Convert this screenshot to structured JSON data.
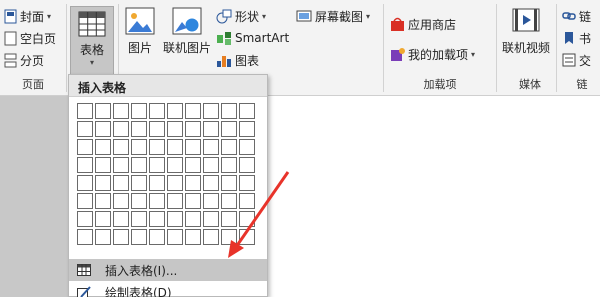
{
  "ribbon": {
    "page_group": {
      "label": "页面",
      "cover": "封面",
      "blank": "空白页",
      "page_break": "分页"
    },
    "table_button": {
      "label": "表格"
    },
    "illustrations": {
      "picture": "图片",
      "online_picture": "联机图片",
      "shapes": "形状",
      "smartart": "SmartArt",
      "chart": "图表",
      "screenshot": "屏幕截图"
    },
    "addins": {
      "label": "加载项",
      "store": "应用商店",
      "my_addins": "我的加载项"
    },
    "media": {
      "label": "媒体",
      "online_video": "联机视频"
    },
    "links": {
      "label": "链",
      "link": "链",
      "bookmark": "书",
      "cross_ref": "交"
    }
  },
  "dropdown": {
    "header": "插入表格",
    "grid_cols": 10,
    "grid_rows": 8,
    "items": [
      {
        "label": "插入表格(I)..."
      },
      {
        "label": "绘制表格(D)"
      }
    ]
  },
  "colors": {
    "ribbon_bg": "#f3f3f3",
    "highlight": "#c6c6c6",
    "arrow": "#e8332a"
  }
}
